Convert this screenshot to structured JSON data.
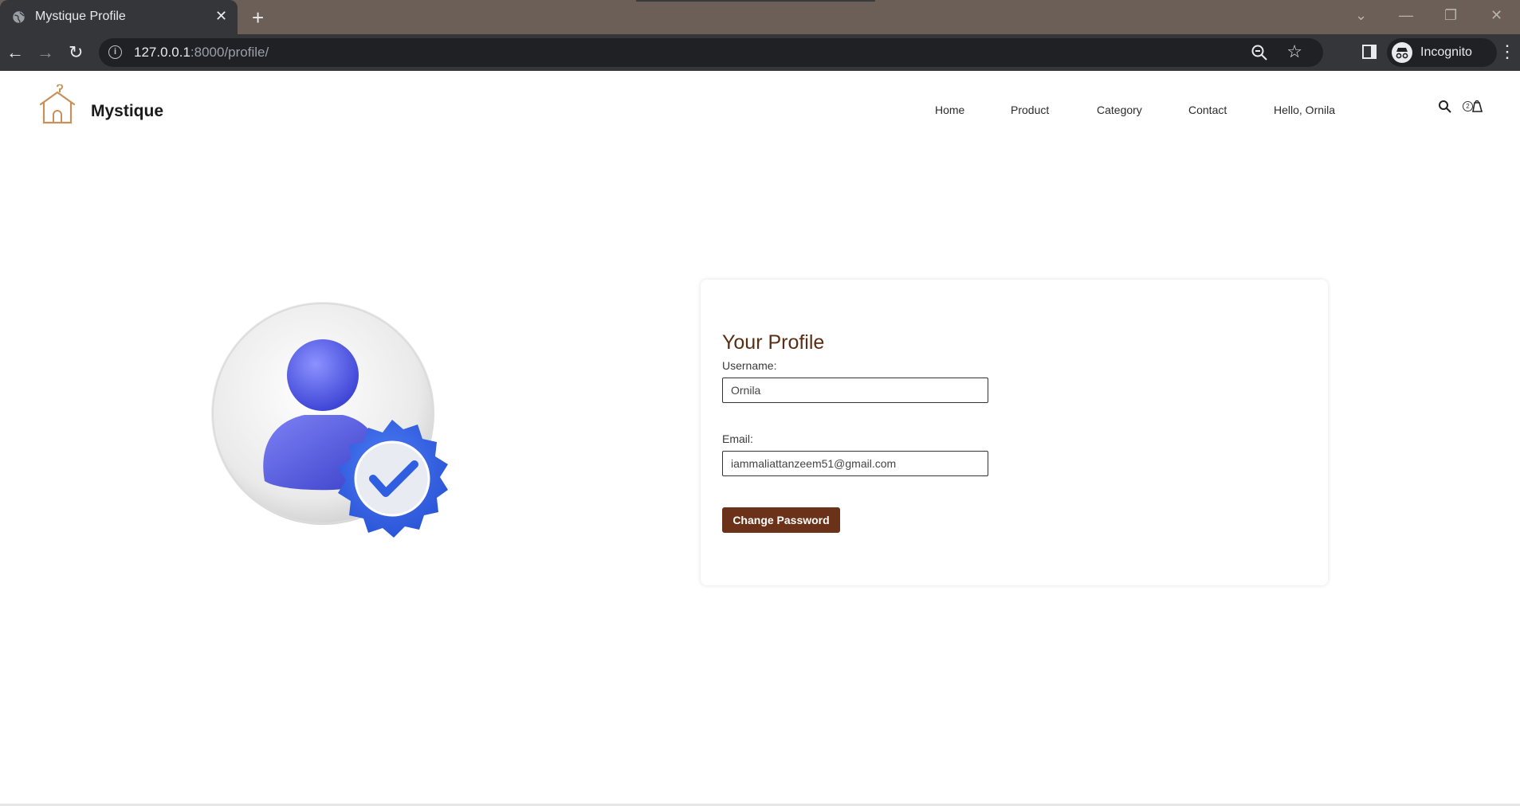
{
  "browser": {
    "tab_title": "Mystique Profile",
    "tab_close": "✕",
    "new_tab": "+",
    "url_host": "127.0.0.1",
    "url_path": ":8000/profile/",
    "info": "i",
    "back": "←",
    "forward": "→",
    "reload": "↻",
    "star": "☆",
    "incognito_label": "Incognito",
    "menu": "⋮",
    "win_dropdown": "⌄",
    "win_minimize": "—",
    "win_restore": "❐",
    "win_close": "✕"
  },
  "header": {
    "brand": "Mystique",
    "nav": [
      "Home",
      "Product",
      "Category",
      "Contact",
      "Hello, Ornila"
    ],
    "cart_count": "2"
  },
  "profile": {
    "title": "Your Profile",
    "username_label": "Username:",
    "username_value": "Ornila",
    "email_label": "Email:",
    "email_value": "iammaliattanzeem51@gmail.com",
    "change_password": "Change Password"
  },
  "colors": {
    "accent": "#6b3219",
    "heading": "#5a2e14",
    "logo": "#c9915a",
    "avatar": "#3f46d6",
    "badge": "#2f5fe0"
  }
}
